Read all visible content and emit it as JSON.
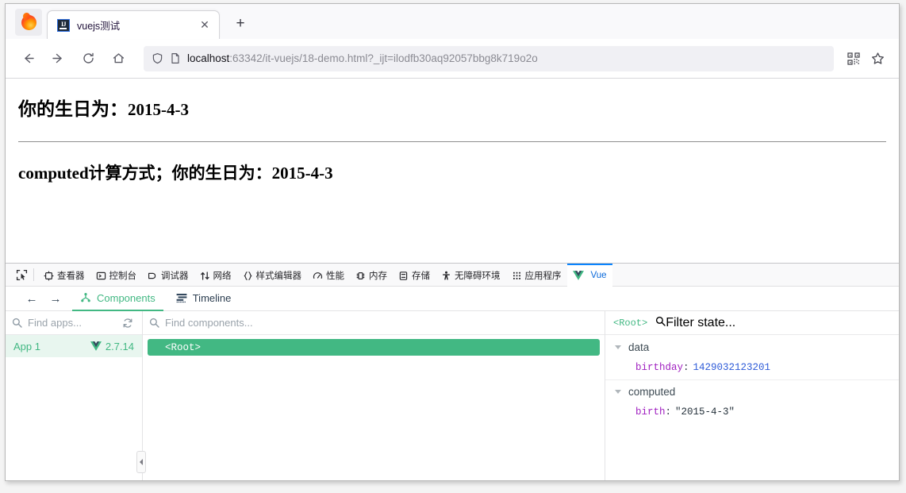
{
  "browser": {
    "app_button": "firefox-menu",
    "tab": {
      "title": "vuejs测试",
      "favicon_label": "IJ",
      "close_label": "✕"
    },
    "new_tab_label": "+",
    "nav": {
      "back": "←",
      "forward": "→",
      "reload": "⟳",
      "home": "⌂"
    },
    "url": {
      "host": "localhost",
      "path": ":63342/it-vuejs/18-demo.html?_ijt=ilodfb30aq92057bbg8k719o2o",
      "shield_icon": "shield-icon",
      "page_icon": "page-icon"
    },
    "url_actions": {
      "qr": "qr-code-icon",
      "bookmark": "star-icon"
    }
  },
  "page": {
    "line1_label": "你的生日为：",
    "line1_value": "2015-4-3",
    "line2_label": "computed计算方式；你的生日为：",
    "line2_value": "2015-4-3"
  },
  "devtools": {
    "toolbar": {
      "picker": "element-picker-icon",
      "tabs": [
        {
          "label": "查看器",
          "icon": "inspector-icon",
          "active": false
        },
        {
          "label": "控制台",
          "icon": "console-icon",
          "active": false
        },
        {
          "label": "调试器",
          "icon": "debugger-icon",
          "active": false
        },
        {
          "label": "网络",
          "icon": "network-icon",
          "active": false
        },
        {
          "label": "样式编辑器",
          "icon": "style-editor-icon",
          "active": false
        },
        {
          "label": "性能",
          "icon": "performance-icon",
          "active": false
        },
        {
          "label": "内存",
          "icon": "memory-icon",
          "active": false
        },
        {
          "label": "存储",
          "icon": "storage-icon",
          "active": false
        },
        {
          "label": "无障碍环境",
          "icon": "accessibility-icon",
          "active": false
        },
        {
          "label": "应用程序",
          "icon": "application-icon",
          "active": false
        },
        {
          "label": "Vue",
          "icon": "vue-logo-icon",
          "active": true
        }
      ]
    },
    "subbar": {
      "back": "←",
      "forward": "→",
      "components_tab": "Components",
      "timeline_tab": "Timeline"
    },
    "apps_pane": {
      "search_placeholder": "Find apps...",
      "refresh_icon": "refresh-icon",
      "app_name": "App 1",
      "app_version": "2.7.14"
    },
    "tree_pane": {
      "search_placeholder": "Find components...",
      "root_node": "<Root>"
    },
    "state_pane": {
      "root_label": "<Root>",
      "filter_placeholder": "Filter state...",
      "sections": [
        {
          "name": "data",
          "entries": [
            {
              "key": "birthday",
              "value": "1429032123201",
              "kind": "number"
            }
          ]
        },
        {
          "name": "computed",
          "entries": [
            {
              "key": "birth",
              "value": "\"2015-4-3\"",
              "kind": "string"
            }
          ]
        }
      ]
    }
  },
  "colors": {
    "vue_green": "#42b883",
    "accent_blue": "#0a84ff",
    "key_purple": "#a020c0",
    "number_blue": "#2e5bd8"
  }
}
